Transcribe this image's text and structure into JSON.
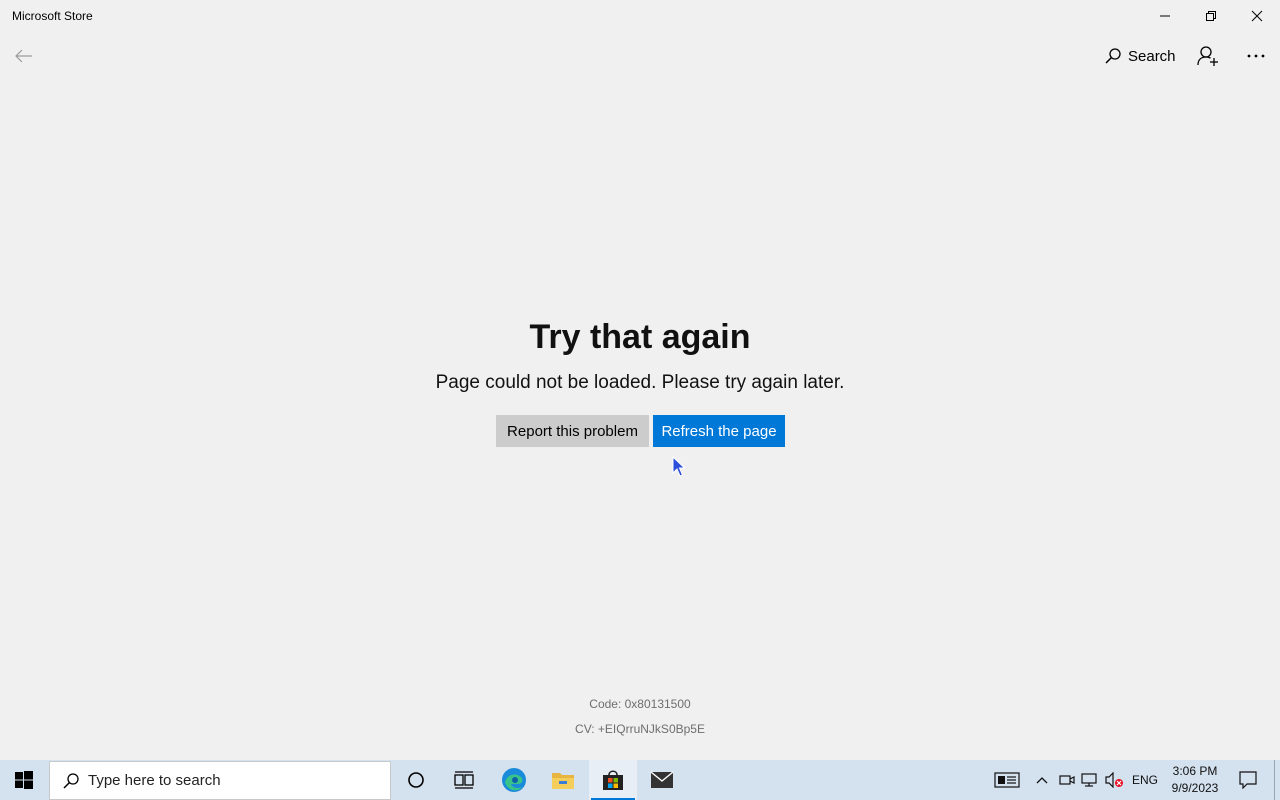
{
  "window": {
    "title": "Microsoft Store"
  },
  "appbar": {
    "search_label": "Search"
  },
  "error": {
    "title": "Try that again",
    "message": "Page could not be loaded. Please try again later.",
    "report_button": "Report this problem",
    "refresh_button": "Refresh the page",
    "code": "Code: 0x80131500",
    "cv": "CV: +EIQrruNJkS0Bp5E"
  },
  "taskbar": {
    "search_placeholder": "Type here to search",
    "pinned_icons": [
      "cortana-icon",
      "task-view-icon",
      "edge-icon",
      "file-explorer-icon",
      "microsoft-store-icon",
      "mail-icon"
    ],
    "active_app": "microsoft-store-icon",
    "language": "ENG",
    "time": "3:06 PM",
    "date": "9/9/2023"
  },
  "colors": {
    "accent": "#0078d7",
    "background": "#f0f0f0",
    "taskbar": "#d4e1ef",
    "secondary_button": "#cccccc"
  }
}
